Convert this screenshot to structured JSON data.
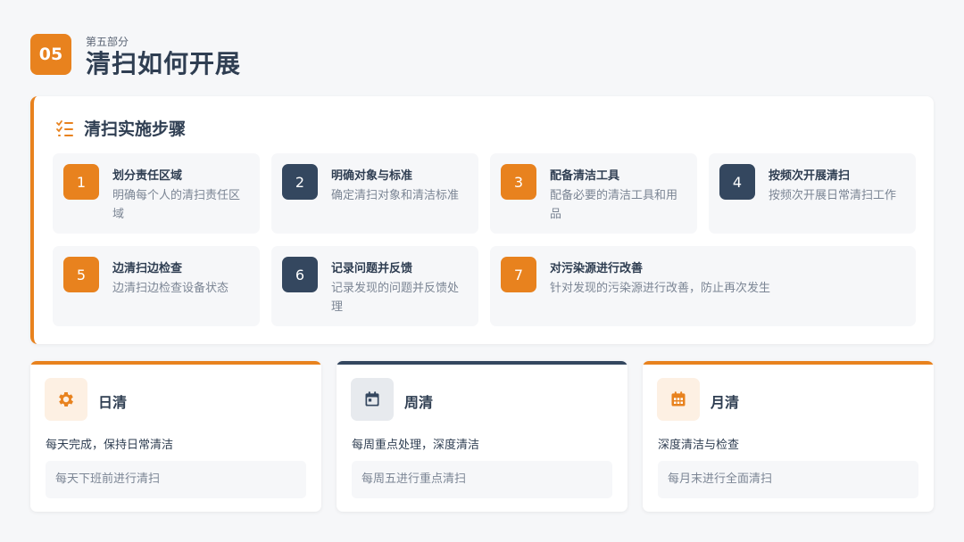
{
  "section": {
    "number": "05",
    "subtitle": "第五部分",
    "title": "清扫如何开展"
  },
  "steps_card": {
    "title": "清扫实施步骤",
    "steps": [
      {
        "num": "1",
        "title": "划分责任区域",
        "desc": "明确每个人的清扫责任区域"
      },
      {
        "num": "2",
        "title": "明确对象与标准",
        "desc": "确定清扫对象和清洁标准"
      },
      {
        "num": "3",
        "title": "配备清洁工具",
        "desc": "配备必要的清洁工具和用品"
      },
      {
        "num": "4",
        "title": "按频次开展清扫",
        "desc": "按频次开展日常清扫工作"
      },
      {
        "num": "5",
        "title": "边清扫边检查",
        "desc": "边清扫边检查设备状态"
      },
      {
        "num": "6",
        "title": "记录问题并反馈",
        "desc": "记录发现的问题并反馈处理"
      },
      {
        "num": "7",
        "title": "对污染源进行改善",
        "desc": "针对发现的污染源进行改善，防止再次发生"
      }
    ]
  },
  "frequency": [
    {
      "title": "日清",
      "desc": "每天完成，保持日常清洁",
      "note": "每天下班前进行清扫",
      "icon": "gear-icon",
      "accent": "#e8821e"
    },
    {
      "title": "周清",
      "desc": "每周重点处理，深度清洁",
      "note": "每周五进行重点清扫",
      "icon": "calendar-day-icon",
      "accent": "#34475f"
    },
    {
      "title": "月清",
      "desc": "深度清洁与检查",
      "note": "每月末进行全面清扫",
      "icon": "calendar-month-icon",
      "accent": "#e8821e"
    }
  ],
  "colors": {
    "orange": "#e8821e",
    "navy": "#34475f",
    "background": "#f6f7f9"
  }
}
